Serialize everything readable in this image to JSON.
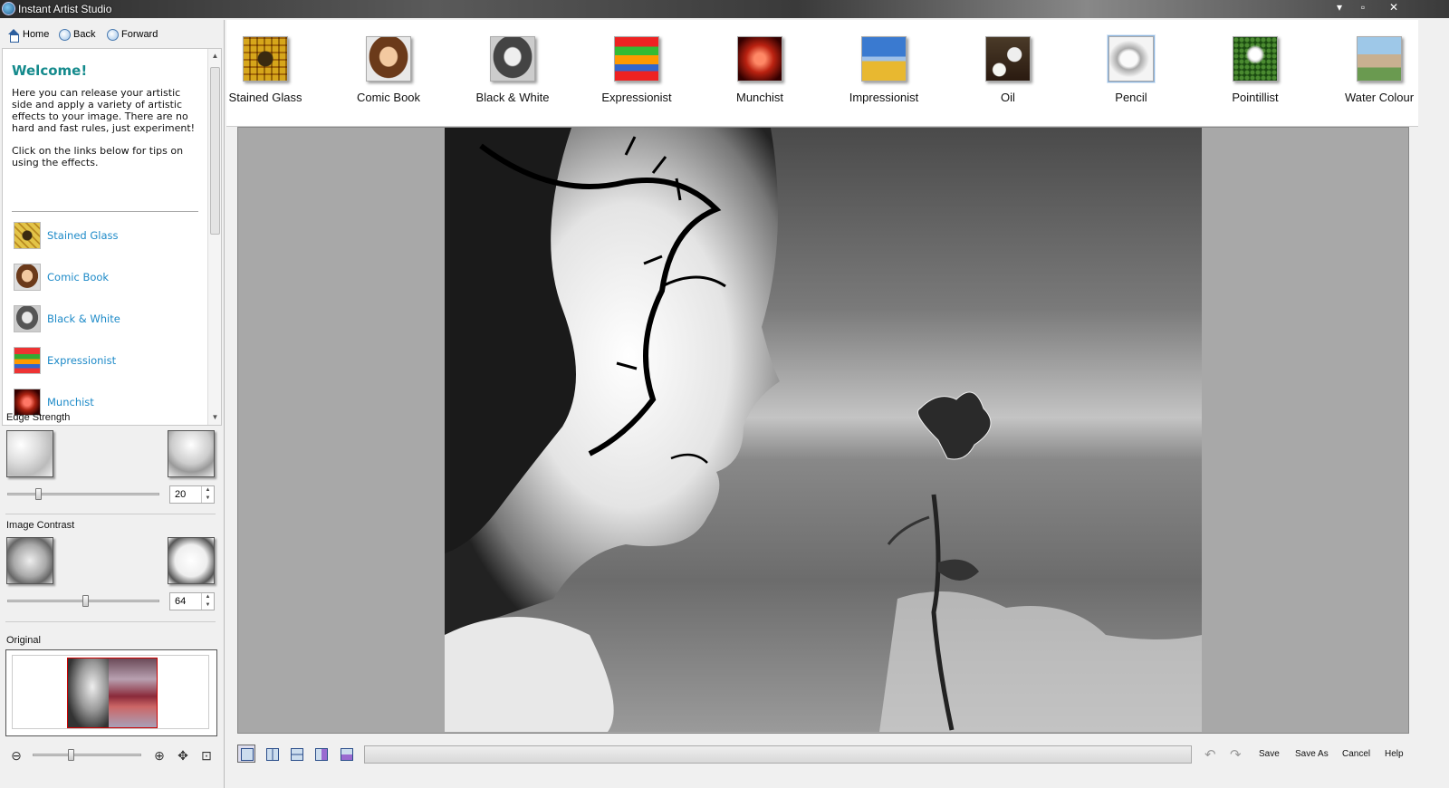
{
  "window": {
    "title": "Instant Artist Studio",
    "controls": [
      "▾",
      "▫",
      "✕"
    ]
  },
  "nav": {
    "home": "Home",
    "back": "Back",
    "forward": "Forward"
  },
  "help": {
    "title": "Welcome!",
    "intro": "Here you can release your artistic side and apply a variety of artistic effects to your image. There are no hard and fast rules, just experiment!",
    "tip_intro": "Click on the links below for tips on using the effects.",
    "links": [
      {
        "label": "Stained Glass",
        "icon": "stained-glass-icon"
      },
      {
        "label": "Comic Book",
        "icon": "comic-book-icon"
      },
      {
        "label": "Black & White",
        "icon": "black-white-icon"
      },
      {
        "label": "Expressionist",
        "icon": "expressionist-icon"
      },
      {
        "label": "Munchist",
        "icon": "munchist-icon"
      }
    ]
  },
  "controls": {
    "edge_strength": {
      "label": "Edge Strength",
      "value": "20",
      "level": 0.2
    },
    "image_contrast": {
      "label": "Image Contrast",
      "value": "64",
      "level": 0.64
    },
    "original_label": "Original"
  },
  "effects": [
    {
      "label": "Stained Glass",
      "icon": "stained-glass-icon",
      "selected": false
    },
    {
      "label": "Comic Book",
      "icon": "comic-book-icon",
      "selected": false
    },
    {
      "label": "Black & White",
      "icon": "black-white-icon",
      "selected": false
    },
    {
      "label": "Expressionist",
      "icon": "expressionist-icon",
      "selected": false
    },
    {
      "label": "Munchist",
      "icon": "munchist-icon",
      "selected": false
    },
    {
      "label": "Impressionist",
      "icon": "impressionist-icon",
      "selected": false
    },
    {
      "label": "Oil",
      "icon": "oil-icon",
      "selected": false
    },
    {
      "label": "Pencil",
      "icon": "pencil-icon",
      "selected": true
    },
    {
      "label": "Pointillist",
      "icon": "pointillist-icon",
      "selected": false
    },
    {
      "label": "Water Colour",
      "icon": "water-colour-icon",
      "selected": false
    }
  ],
  "bottom": {
    "save": "Save",
    "save_as": "Save As",
    "cancel": "Cancel",
    "help": "Help"
  },
  "colors": {
    "accent_link": "#1d8ac8",
    "welcome_title": "#148a8c",
    "canvas_bg": "#a8a8a8"
  }
}
